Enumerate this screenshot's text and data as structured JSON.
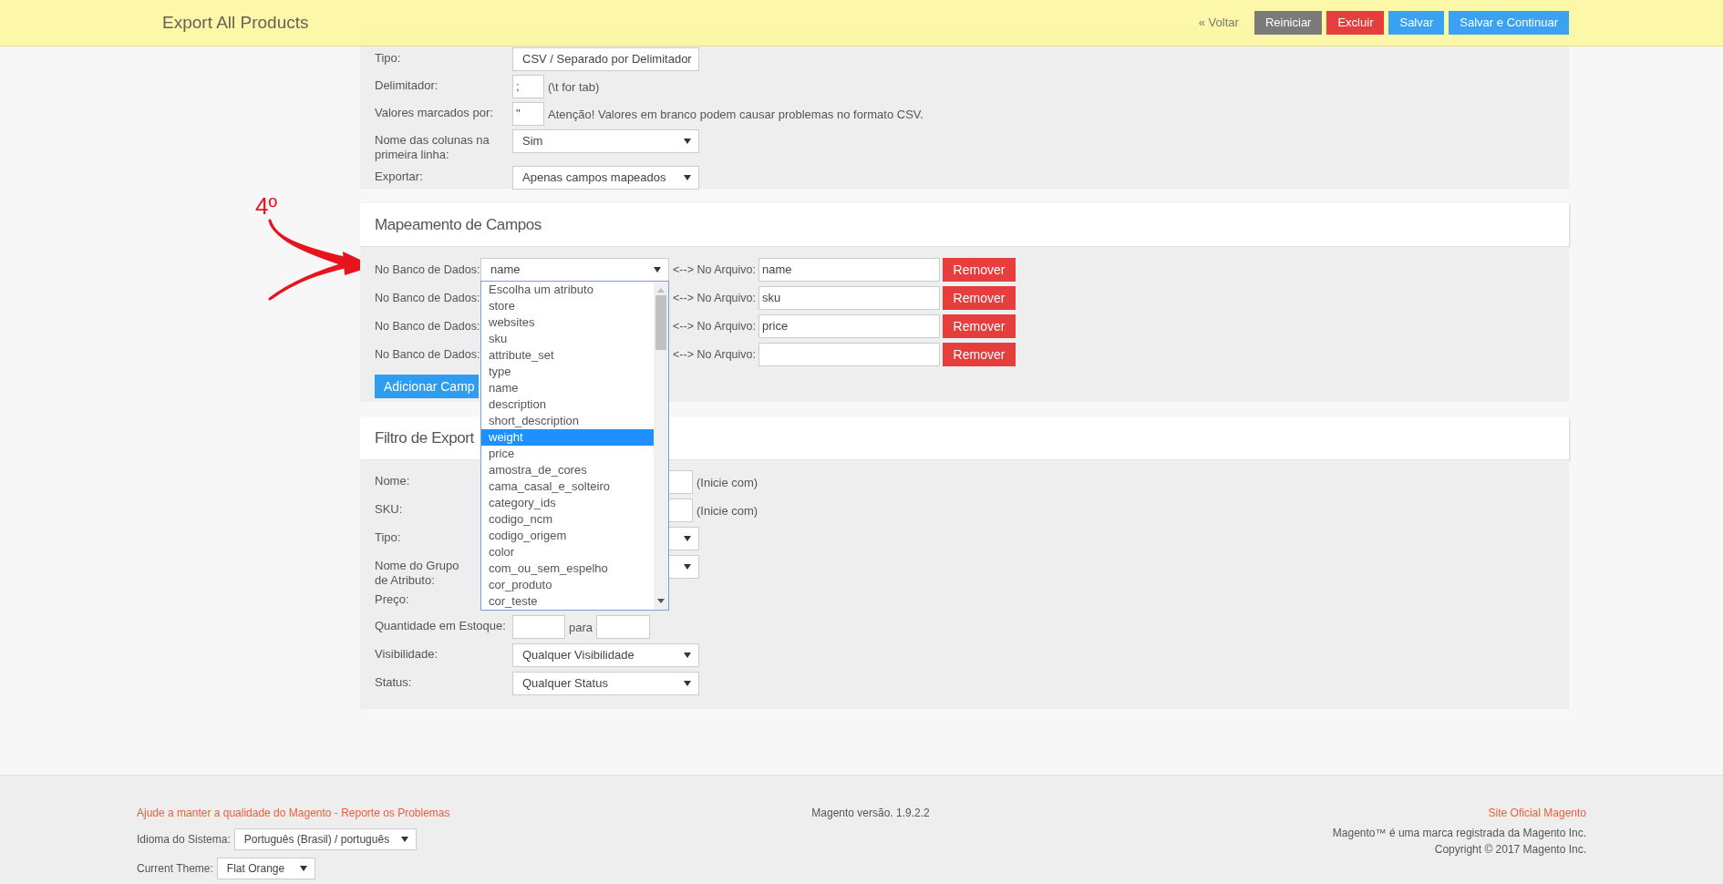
{
  "header": {
    "title": "Export All Products",
    "back_link": "« Voltar",
    "buttons": [
      {
        "label": "Reiniciar",
        "kind": "neutral"
      },
      {
        "label": "Excluir",
        "kind": "danger"
      },
      {
        "label": "Salvar",
        "kind": "primary"
      },
      {
        "label": "Salvar e Continuar",
        "kind": "primary"
      }
    ]
  },
  "format_section": {
    "fields": [
      {
        "label": "Tipo:",
        "kind": "select",
        "value": "CSV / Separado por Delimitador"
      },
      {
        "label": "Delimitador:",
        "kind": "short",
        "value": ";",
        "note": "(\\t for tab)"
      },
      {
        "label": "Valores marcados por:",
        "kind": "short",
        "value": "\"",
        "note": "Atenção! Valores em branco podem causar problemas no formato CSV."
      },
      {
        "label": "Nome das colunas na primeira linha:",
        "kind": "select",
        "value": "Sim"
      },
      {
        "label": "Exportar:",
        "kind": "select",
        "value": "Apenas campos mapeados"
      }
    ]
  },
  "annotation": {
    "label": "4º"
  },
  "mapping_section": {
    "title": "Mapeamento de Campos",
    "rows": [
      {
        "db_label": "No Banco de Dados:",
        "db_value": "name",
        "file_label": "<--> No Arquivo:",
        "file_value": "name",
        "remove_label": "Remover"
      },
      {
        "db_label": "No Banco de Dados:",
        "file_label": "<--> No Arquivo:",
        "file_value": "sku",
        "remove_label": "Remover"
      },
      {
        "db_label": "No Banco de Dados:",
        "file_label": "<--> No Arquivo:",
        "file_value": "price",
        "remove_label": "Remover"
      },
      {
        "db_label": "No Banco de Dados:",
        "file_label": "<--> No Arquivo:",
        "remove_label": "Remover"
      }
    ],
    "add_button": "Adicionar Camp",
    "dropdown": {
      "options": [
        {
          "label": "Escolha um atributo",
          "selected": false
        },
        {
          "label": "store",
          "selected": false
        },
        {
          "label": "websites",
          "selected": false
        },
        {
          "label": "sku",
          "selected": false
        },
        {
          "label": "attribute_set",
          "selected": false
        },
        {
          "label": "type",
          "selected": false
        },
        {
          "label": "name",
          "selected": false
        },
        {
          "label": "description",
          "selected": false
        },
        {
          "label": "short_description",
          "selected": false
        },
        {
          "label": "weight",
          "selected": true
        },
        {
          "label": "price",
          "selected": false
        },
        {
          "label": "amostra_de_cores",
          "selected": false
        },
        {
          "label": "cama_casal_e_solteiro",
          "selected": false
        },
        {
          "label": "category_ids",
          "selected": false
        },
        {
          "label": "codigo_ncm",
          "selected": false
        },
        {
          "label": "codigo_origem",
          "selected": false
        },
        {
          "label": "color",
          "selected": false
        },
        {
          "label": "com_ou_sem_espelho",
          "selected": false
        },
        {
          "label": "cor_produto",
          "selected": false
        },
        {
          "label": "cor_teste",
          "selected": false
        }
      ]
    }
  },
  "filter_section": {
    "title": "Filtro de Export",
    "fields": [
      {
        "label": "Nome:",
        "kind": "text",
        "note": "(Inicie com)"
      },
      {
        "label": "SKU:",
        "kind": "text",
        "note": "(Inicie com)"
      },
      {
        "label": "Tipo:",
        "kind": "select"
      },
      {
        "label": "Nome do Grupo de Atributo:",
        "kind": "select"
      },
      {
        "label": "Preço:",
        "kind": "hidden"
      },
      {
        "label": "Quantidade em Estoque:",
        "kind": "range",
        "separator": "para"
      },
      {
        "label": "Visibilidade:",
        "kind": "select",
        "value": "Qualquer Visibilidade"
      },
      {
        "label": "Status:",
        "kind": "select",
        "value": "Qualquer Status"
      }
    ]
  },
  "footer": {
    "report_link": "Ajude a manter a qualidade do Magento - Reporte os Problemas",
    "version": "Magento versão. 1.9.2.2",
    "official_link": "Site Oficial Magento",
    "trademark": "Magento™ é uma marca registrada da Magento Inc.",
    "copyright": "Copyright © 2017 Magento Inc.",
    "language_label": "Idioma do Sistema:",
    "language_value": "Português (Brasil) / português",
    "theme_label": "Current Theme:",
    "theme_value": "Flat Orange"
  }
}
